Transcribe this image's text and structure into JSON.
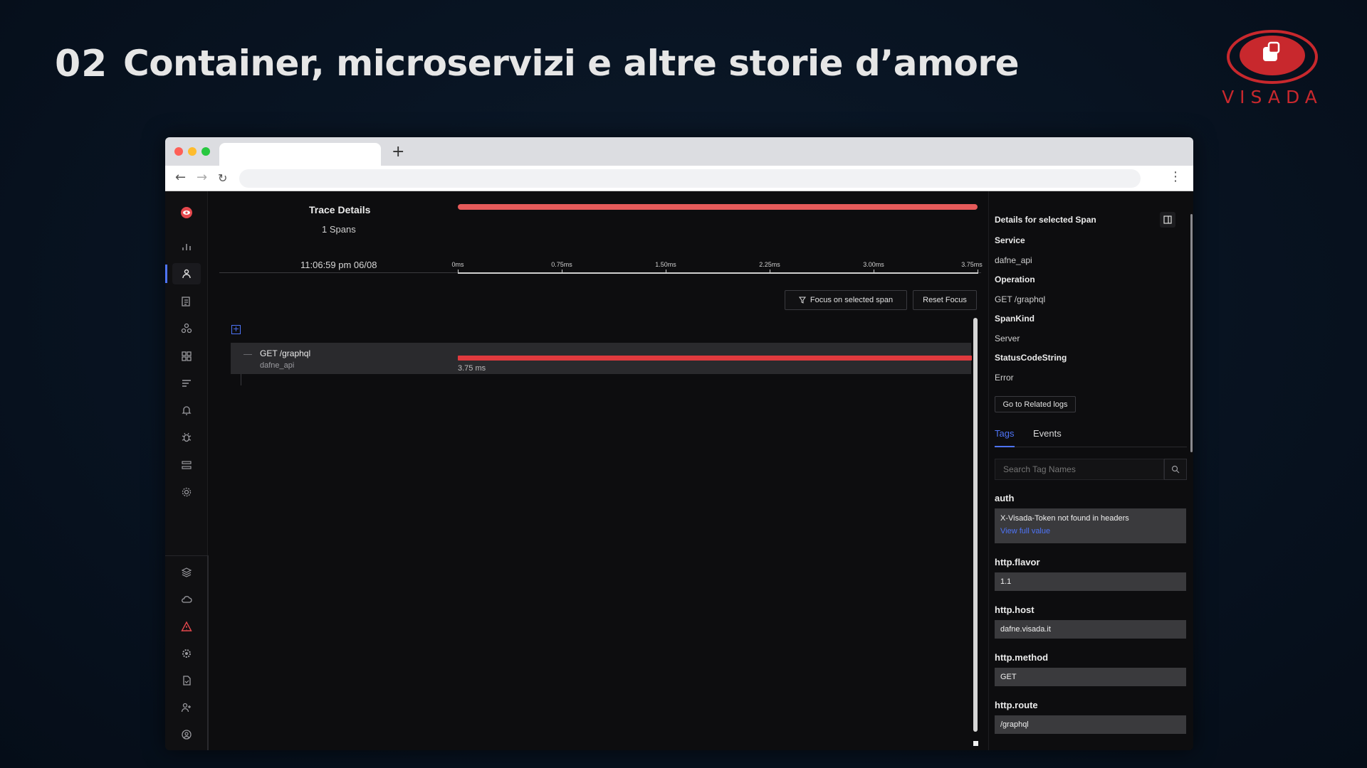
{
  "slide": {
    "number": "02",
    "title": "Container, microservizi e altre storie d’amore",
    "logo_text": "VISADA"
  },
  "browser": {
    "new_tab_label": "+",
    "back_icon": "arrow-left-icon",
    "forward_icon": "arrow-right-icon",
    "reload_icon": "reload-icon",
    "menu_icon": "kebab-menu-icon"
  },
  "trace": {
    "title": "Trace Details",
    "span_count": "1 Spans",
    "timestamp": "11:06:59 pm 06/08",
    "ticks": [
      "0ms",
      "0.75ms",
      "1.50ms",
      "2.25ms",
      "3.00ms",
      "3.75ms"
    ],
    "focus_button": "Focus on selected span",
    "reset_button": "Reset Focus",
    "span": {
      "name": "GET /graphql",
      "service": "dafne_api",
      "duration": "3.75 ms"
    },
    "colors": {
      "error_bar": "#e03a3e",
      "accent": "#4e74f8"
    }
  },
  "panel": {
    "title": "Details for selected Span",
    "fields": [
      {
        "key": "Service",
        "value": "dafne_api"
      },
      {
        "key": "Operation",
        "value": "GET /graphql"
      },
      {
        "key": "SpanKind",
        "value": "Server"
      },
      {
        "key": "StatusCodeString",
        "value": "Error"
      }
    ],
    "logs_button": "Go to Related logs",
    "tabs": [
      "Tags",
      "Events"
    ],
    "search_placeholder": "Search Tag Names",
    "tags": [
      {
        "key": "auth",
        "value": "X-Visada-Token not found in headers",
        "link": "View full value"
      },
      {
        "key": "http.flavor",
        "value": "1.1"
      },
      {
        "key": "http.host",
        "value": "dafne.visada.it"
      },
      {
        "key": "http.method",
        "value": "GET"
      },
      {
        "key": "http.route",
        "value": "/graphql"
      }
    ]
  }
}
